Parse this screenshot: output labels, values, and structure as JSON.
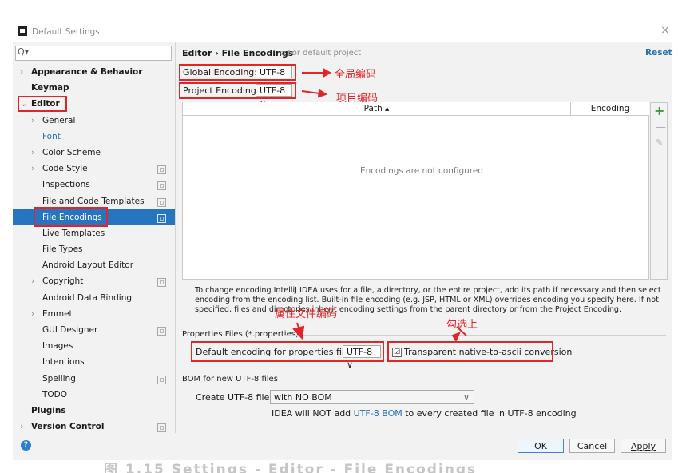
{
  "window": {
    "title": "Default Settings",
    "close_glyph": "×"
  },
  "sidebar": {
    "search_glyph": "Q▾",
    "items": [
      {
        "label": "Appearance & Behavior",
        "arrow": "›"
      },
      {
        "label": "Keymap"
      },
      {
        "label": "Editor",
        "arrow": "⌄"
      },
      {
        "label": "General",
        "arrow": "›"
      },
      {
        "label": "Font"
      },
      {
        "label": "Color Scheme",
        "arrow": "›"
      },
      {
        "label": "Code Style",
        "arrow": "›"
      },
      {
        "label": "Inspections"
      },
      {
        "label": "File and Code Templates"
      },
      {
        "label": "File Encodings"
      },
      {
        "label": "Live Templates"
      },
      {
        "label": "File Types"
      },
      {
        "label": "Android Layout Editor"
      },
      {
        "label": "Copyright",
        "arrow": "›"
      },
      {
        "label": "Android Data Binding"
      },
      {
        "label": "Emmet",
        "arrow": "›"
      },
      {
        "label": "GUI Designer"
      },
      {
        "label": "Images"
      },
      {
        "label": "Intentions"
      },
      {
        "label": "Spelling"
      },
      {
        "label": "TODO"
      },
      {
        "label": "Plugins"
      },
      {
        "label": "Version Control",
        "arrow": "›"
      }
    ]
  },
  "main": {
    "breadcrumb": "Editor › File Encodings",
    "breadcrumb_sub": "⧉ For default project",
    "reset_label": "Reset",
    "global_label": "Global Encoding:",
    "global_value": "UTF-8 ∨",
    "project_label": "Project Encoding:",
    "project_value": "UTF-8 ∨",
    "table": {
      "col_path": "Path ▴",
      "col_encoding": "Encoding",
      "empty": "Encodings are not configured",
      "add": "+",
      "remove": "—",
      "edit": "✎"
    },
    "description": "To change encoding IntelliJ IDEA uses for a file, a directory, or the entire project, add its path if necessary and then select encoding from the encoding list. Built-in file encoding (e.g. JSP, HTML or XML) overrides encoding you specify here. If not specified, files and directories inherit encoding settings from the parent directory or from the Project Encoding.",
    "properties_section": "Properties Files (*.properties)",
    "properties_label": "Default encoding for properties files:",
    "properties_value": "UTF-8 ∨",
    "transparent_label": "Transparent native-to-ascii conversion",
    "transparent_checked": "☑",
    "bom_section": "BOM for new UTF-8 files",
    "bom_label": "Create UTF-8 files:",
    "bom_value": "with NO BOM",
    "bom_arrow": "∨",
    "bom_note_pre": "IDEA will NOT add ",
    "bom_note_link": "UTF-8 BOM",
    "bom_note_post": " to every created file in UTF-8 encoding"
  },
  "footer": {
    "help": "?",
    "ok": "OK",
    "cancel": "Cancel",
    "apply": "Apply"
  },
  "annotations": {
    "global": "全局编码",
    "project": "项目编码",
    "properties": "属性文件编码",
    "check": "勾选上",
    "color": "#e0262b"
  },
  "bottom_caption_fragment": "图 1.15  Settings - Editor - File Encodings"
}
